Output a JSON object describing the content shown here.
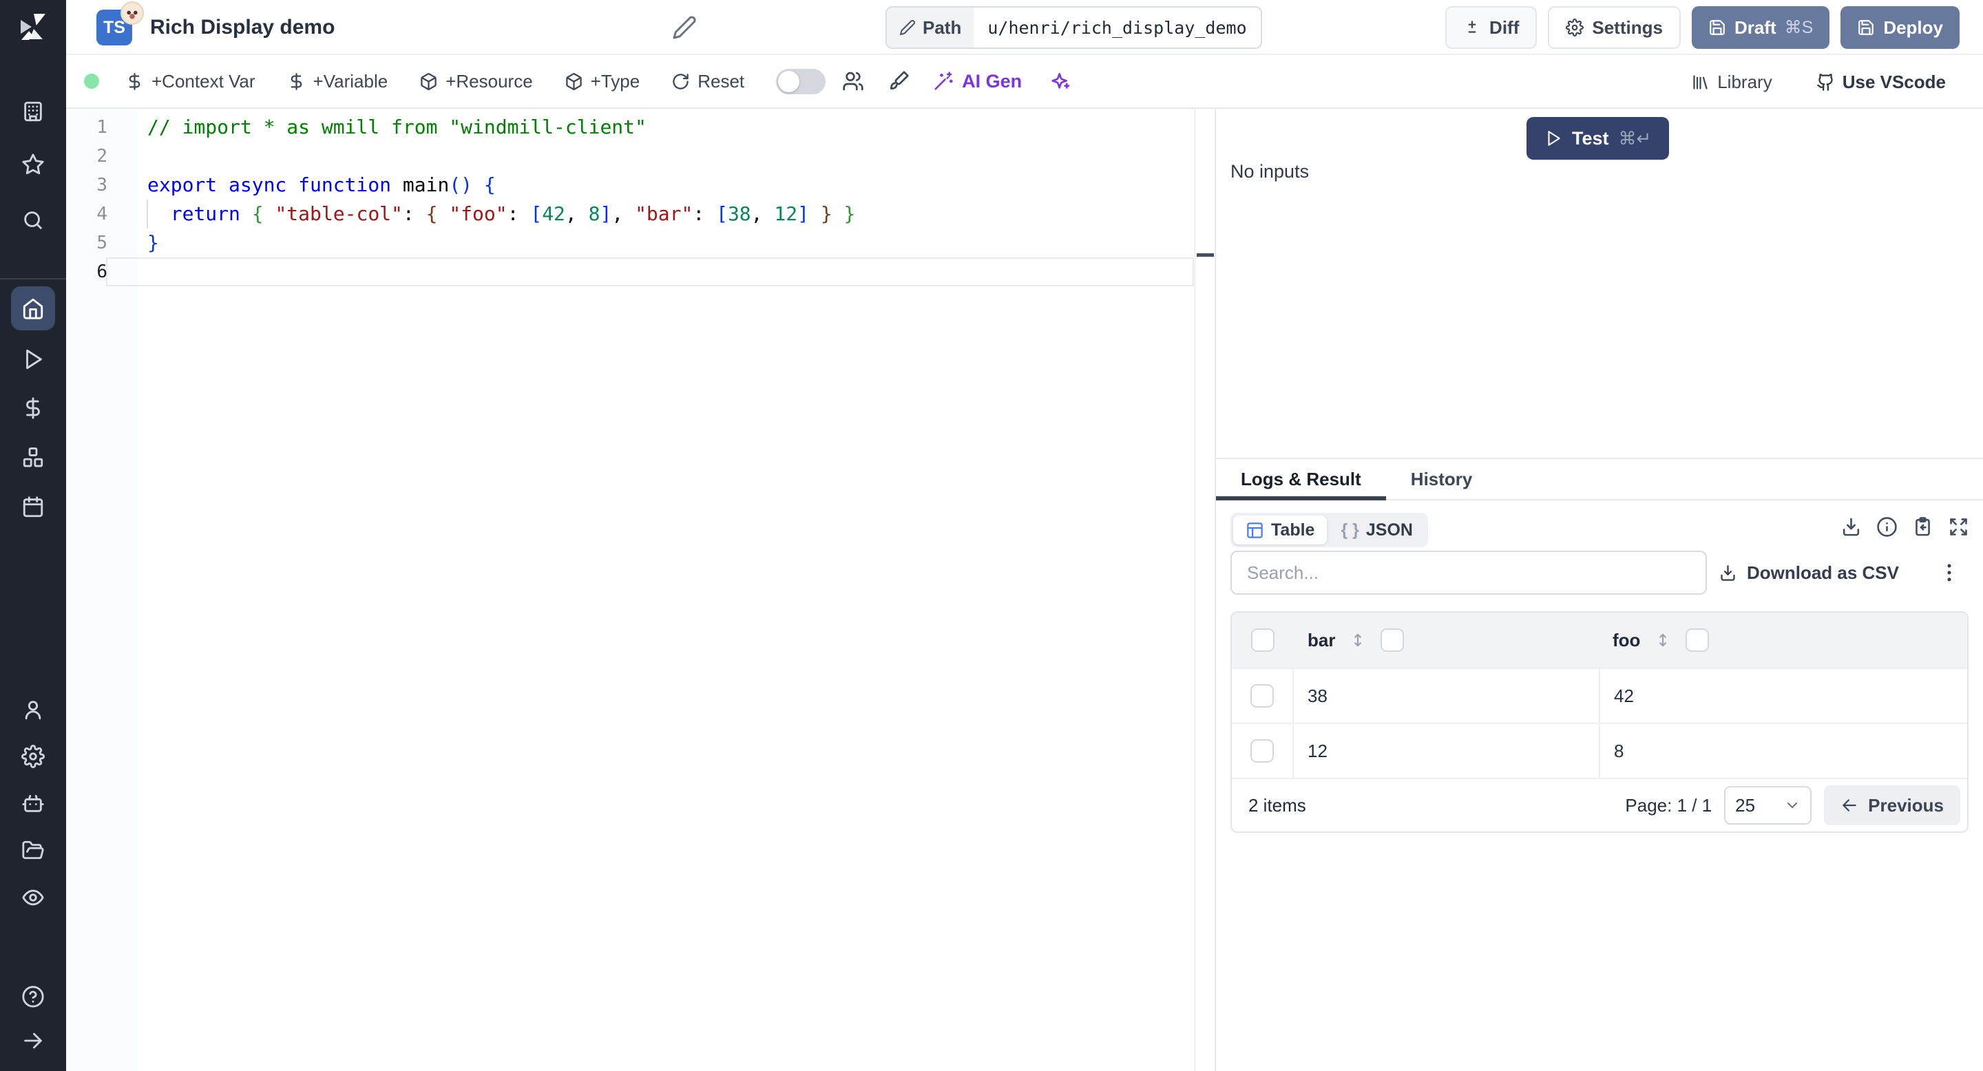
{
  "header": {
    "language_badge": "TS",
    "title": "Rich Display demo",
    "path_label": "Path",
    "path_value": "u/henri/rich_display_demo",
    "buttons": {
      "diff": "Diff",
      "settings": "Settings",
      "draft": "Draft",
      "draft_shortcut": "⌘S",
      "deploy": "Deploy"
    }
  },
  "toolbar": {
    "context_var": "+Context Var",
    "variable": "+Variable",
    "resource": "+Resource",
    "type": "+Type",
    "reset": "Reset",
    "ai_gen": "AI Gen",
    "library": "Library",
    "use_vscode": "Use VScode"
  },
  "editor": {
    "lines": [
      {
        "num": 1,
        "tokens": [
          {
            "t": "// import * as wmill from \"windmill-client\"",
            "c": "comment"
          }
        ]
      },
      {
        "num": 2,
        "tokens": []
      },
      {
        "num": 3,
        "tokens": [
          {
            "t": "export async function",
            "c": "kw"
          },
          {
            "t": " main",
            "c": "plain"
          },
          {
            "t": "()",
            "c": "b1"
          },
          {
            "t": " ",
            "c": "plain"
          },
          {
            "t": "{",
            "c": "b1"
          }
        ]
      },
      {
        "num": 4,
        "tokens": [
          {
            "t": "  ",
            "c": "plain"
          },
          {
            "t": "return",
            "c": "kw"
          },
          {
            "t": " ",
            "c": "plain"
          },
          {
            "t": "{",
            "c": "b2"
          },
          {
            "t": " ",
            "c": "plain"
          },
          {
            "t": "\"table-col\"",
            "c": "str"
          },
          {
            "t": ": ",
            "c": "plain"
          },
          {
            "t": "{",
            "c": "b3"
          },
          {
            "t": " ",
            "c": "plain"
          },
          {
            "t": "\"foo\"",
            "c": "str"
          },
          {
            "t": ": ",
            "c": "plain"
          },
          {
            "t": "[",
            "c": "b1"
          },
          {
            "t": "42",
            "c": "num"
          },
          {
            "t": ", ",
            "c": "plain"
          },
          {
            "t": "8",
            "c": "num"
          },
          {
            "t": "]",
            "c": "b1"
          },
          {
            "t": ", ",
            "c": "plain"
          },
          {
            "t": "\"bar\"",
            "c": "str"
          },
          {
            "t": ": ",
            "c": "plain"
          },
          {
            "t": "[",
            "c": "b1"
          },
          {
            "t": "38",
            "c": "num"
          },
          {
            "t": ", ",
            "c": "plain"
          },
          {
            "t": "12",
            "c": "num"
          },
          {
            "t": "]",
            "c": "b1"
          },
          {
            "t": " ",
            "c": "plain"
          },
          {
            "t": "}",
            "c": "b3"
          },
          {
            "t": " ",
            "c": "plain"
          },
          {
            "t": "}",
            "c": "b2"
          }
        ]
      },
      {
        "num": 5,
        "tokens": [
          {
            "t": "}",
            "c": "b1"
          }
        ]
      },
      {
        "num": 6,
        "tokens": [],
        "current": true
      }
    ]
  },
  "run": {
    "test_label": "Test",
    "test_shortcut": "⌘↵",
    "no_inputs": "No inputs"
  },
  "result": {
    "tabs": [
      {
        "label": "Logs & Result",
        "active": true
      },
      {
        "label": "History",
        "active": false
      }
    ],
    "view": {
      "table_label": "Table",
      "json_braces": "{ }",
      "json_label": "JSON"
    },
    "search_placeholder": "Search...",
    "download_csv": "Download as CSV",
    "table": {
      "columns": [
        "bar",
        "foo"
      ],
      "rows": [
        [
          "38",
          "42"
        ],
        [
          "12",
          "8"
        ]
      ],
      "items_label": "2 items",
      "page_label": "Page: 1 / 1",
      "page_size": "25",
      "previous_label": "Previous"
    }
  },
  "colors": {
    "sidebar_bg": "#1f242e",
    "sidebar_active": "#3e4c6c",
    "ts_badge": "#3b72cd",
    "slate_button": "#68799e",
    "test_button": "#35426b",
    "ai_accent": "#7d33e0",
    "status_dot": "#88e5aa",
    "table_icon": "#4a7df2"
  }
}
